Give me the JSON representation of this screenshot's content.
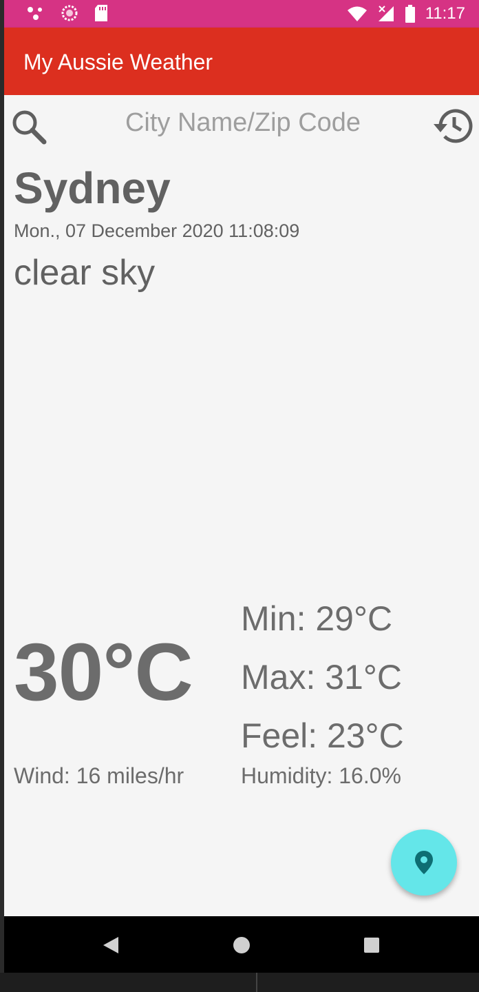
{
  "status_bar": {
    "time": "11:17",
    "left_icons": [
      "share-dots-icon",
      "sync-circle-icon",
      "sd-card-icon"
    ],
    "right_icons": [
      "wifi-icon",
      "cellular-no-signal-icon",
      "battery-icon"
    ]
  },
  "app_bar": {
    "title": "My Aussie Weather",
    "color": "#dc2f1f"
  },
  "search": {
    "placeholder": "City Name/Zip Code",
    "value": ""
  },
  "weather": {
    "city": "Sydney",
    "datetime": "Mon., 07 December 2020 11:08:09",
    "description": "clear sky",
    "temperature": "30°C",
    "min": "Min: 29°C",
    "max": "Max: 31°C",
    "feel": "Feel: 23°C",
    "wind": "Wind: 16 miles/hr",
    "humidity": "Humidity: 16.0%"
  },
  "fab": {
    "icon": "location-pin-icon",
    "color": "#64e6e9"
  },
  "nav_bar": {
    "buttons": [
      "back-icon",
      "home-icon",
      "recents-icon"
    ]
  }
}
